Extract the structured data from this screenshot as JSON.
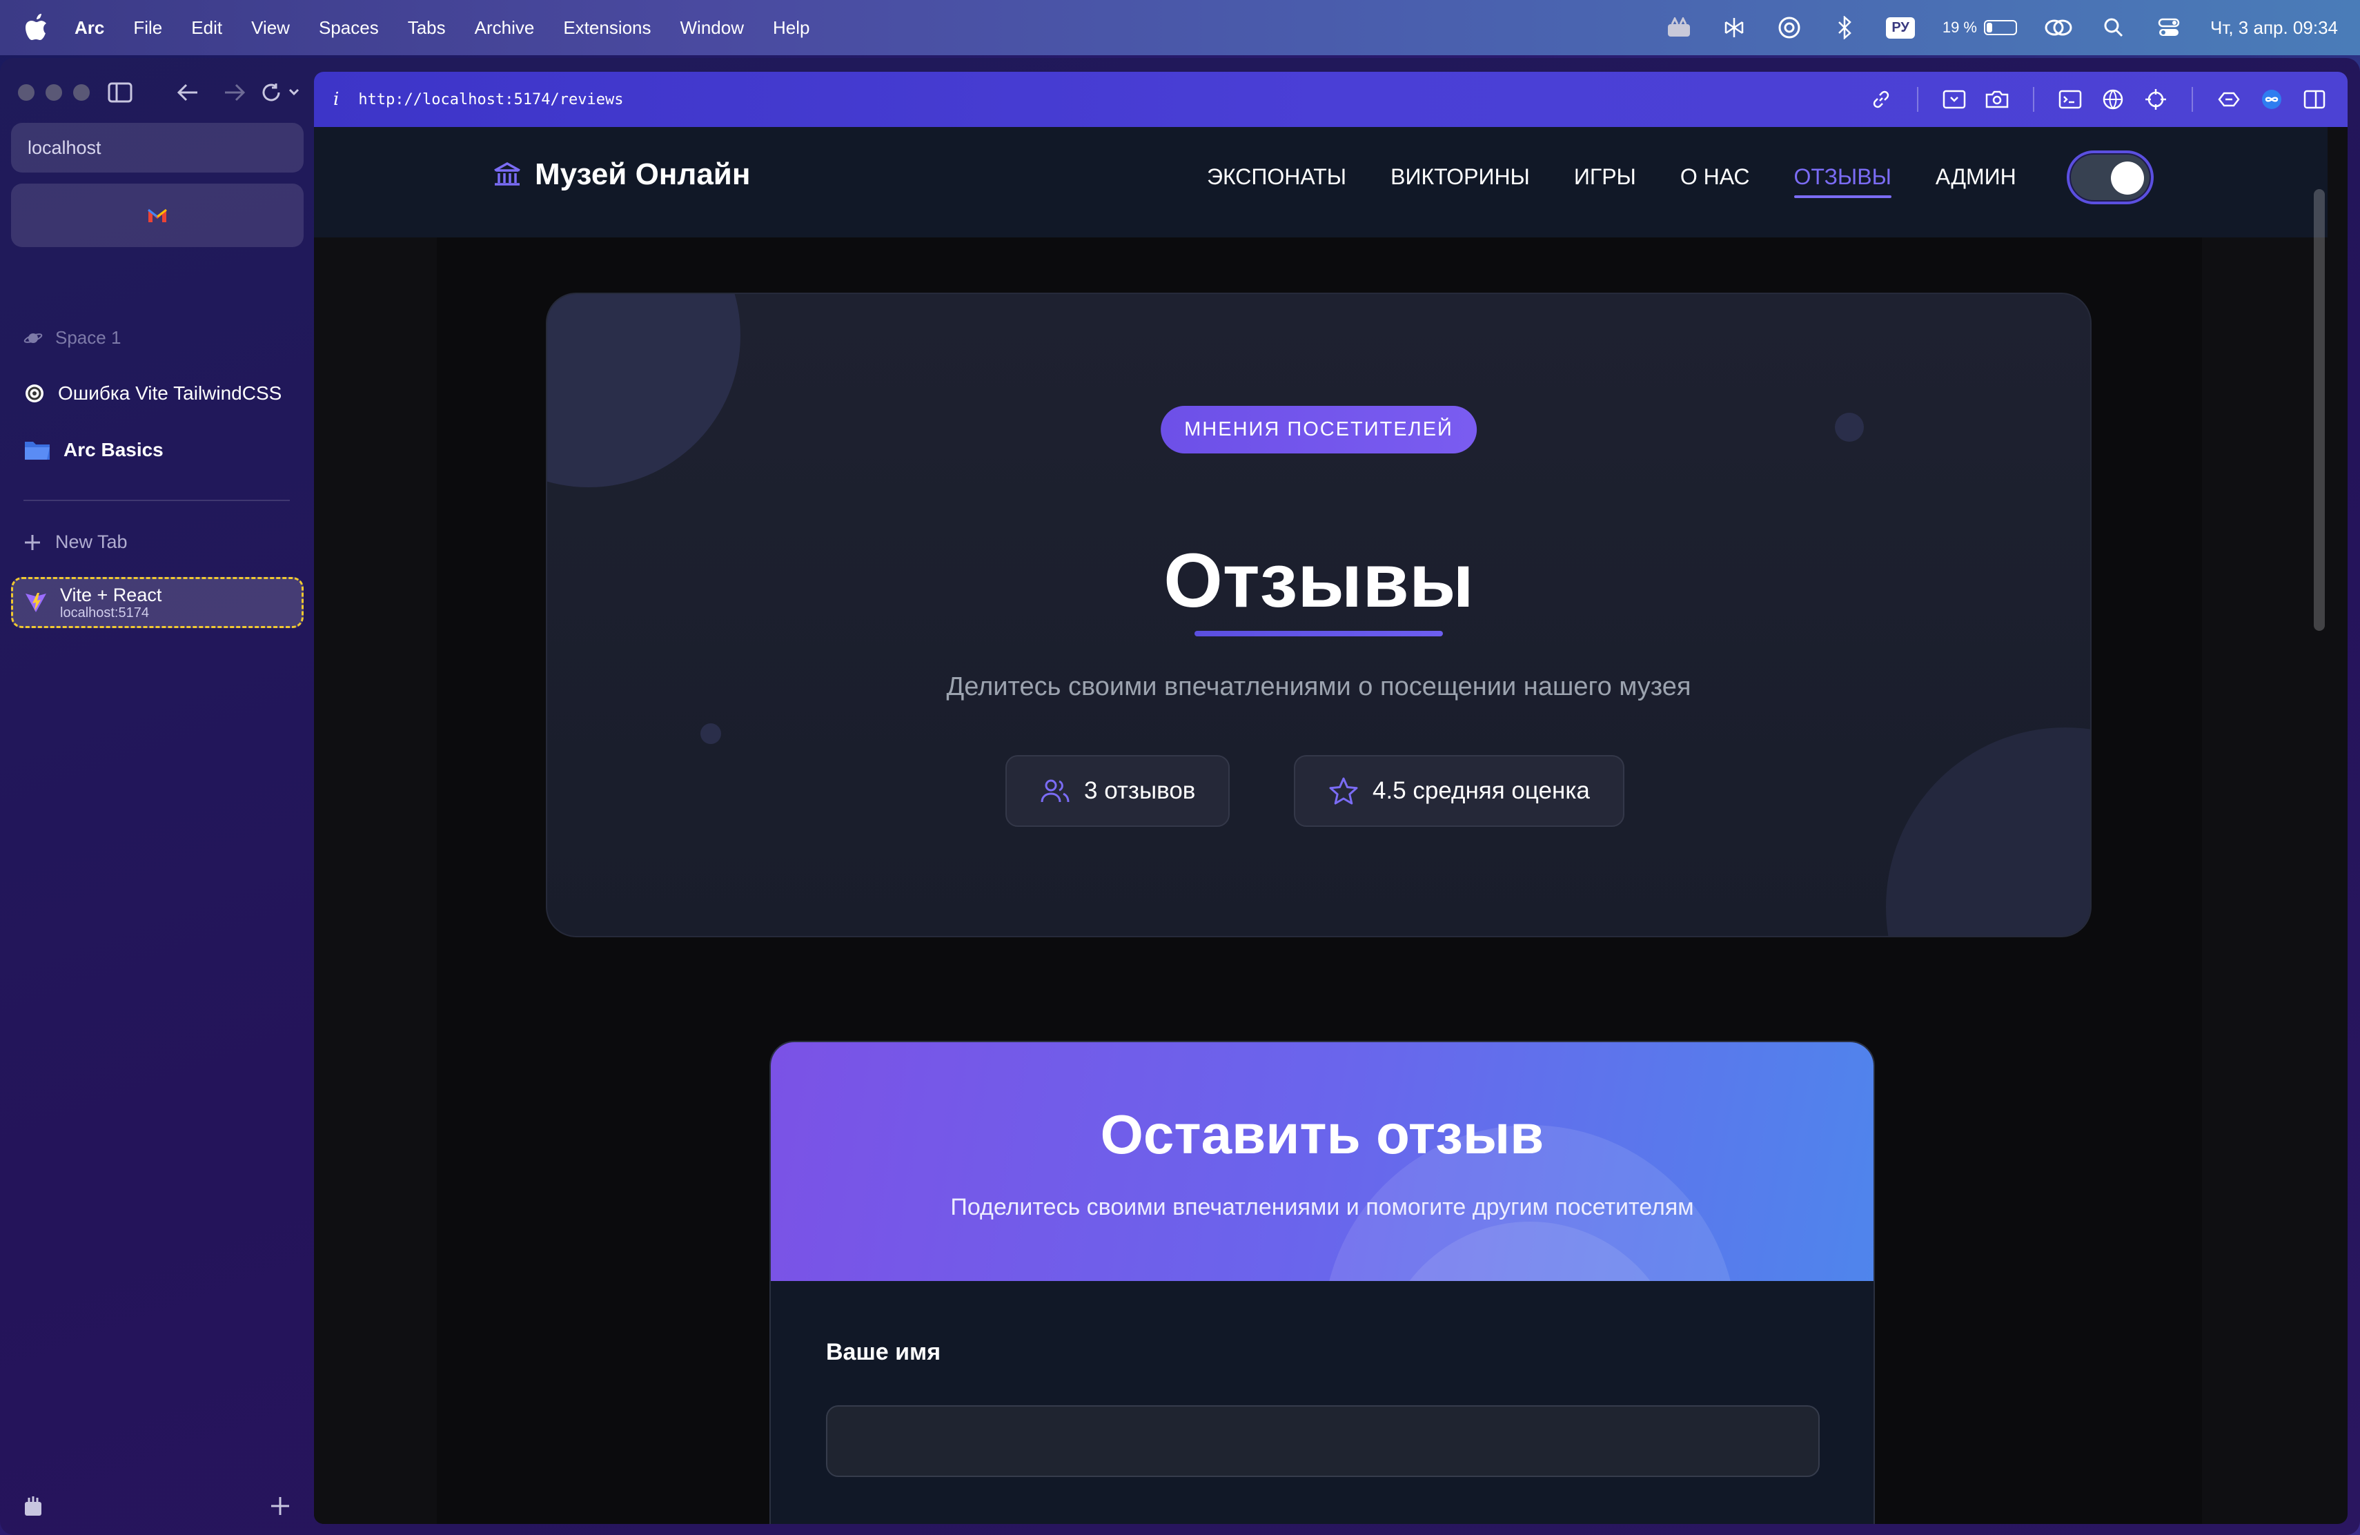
{
  "menubar": {
    "app_name": "Arc",
    "items": [
      "File",
      "Edit",
      "View",
      "Spaces",
      "Tabs",
      "Archive",
      "Extensions",
      "Window",
      "Help"
    ],
    "language": "РУ",
    "battery_text": "19 %",
    "battery_level": 0.19,
    "datetime": "Чт, 3 апр.  09:34"
  },
  "sidebar": {
    "url_text": "localhost",
    "space_name": "Space 1",
    "pinned": [
      {
        "label": "Ошибка Vite TailwindCSS",
        "icon": "openai-icon"
      },
      {
        "label": "Arc Basics",
        "icon": "folder-icon"
      }
    ],
    "new_tab_label": "New Tab",
    "active_tab": {
      "title": "Vite + React",
      "subtitle": "localhost:5174"
    }
  },
  "browser": {
    "url": "http://localhost:5174/reviews",
    "accent": "#4a3fd6"
  },
  "site": {
    "logo_text": "Музей Онлайн",
    "nav": [
      "ЭКСПОНАТЫ",
      "ВИКТОРИНЫ",
      "ИГРЫ",
      "О НАС",
      "ОТЗЫВЫ",
      "АДМИН"
    ],
    "active_nav": "ОТЗЫВЫ",
    "theme_toggle_on": true
  },
  "hero": {
    "badge": "МНЕНИЯ ПОСЕТИТЕЛЕЙ",
    "title": "Отзывы",
    "subtitle": "Делитесь своими впечатлениями о посещении нашего музея",
    "stats": [
      {
        "icon": "users-icon",
        "text": "3 отзывов"
      },
      {
        "icon": "star-icon",
        "text": "4.5 средняя оценка"
      }
    ]
  },
  "form": {
    "title": "Оставить отзыв",
    "subtitle": "Поделитесь своими впечатлениями и помогите другим посетителям",
    "name_label": "Ваше имя",
    "name_value": ""
  }
}
